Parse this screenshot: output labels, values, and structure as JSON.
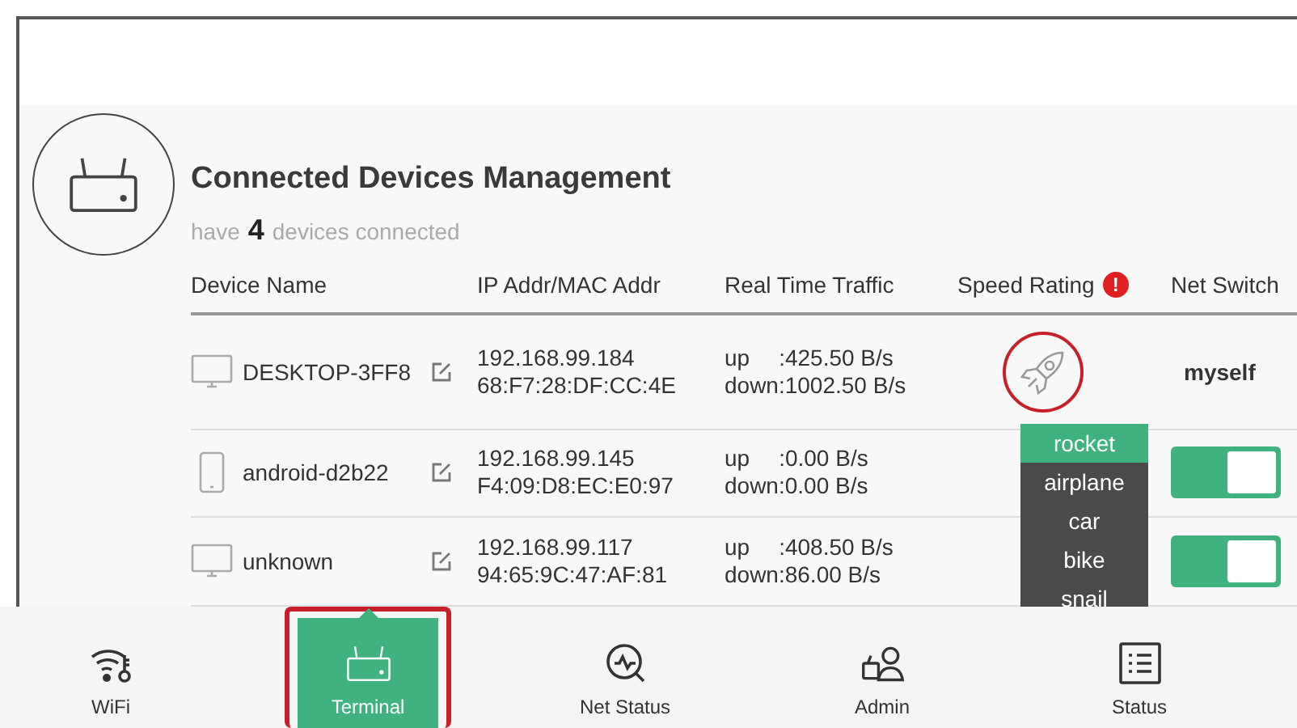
{
  "header": {
    "title": "Connected Devices Management",
    "count_prefix": "have",
    "count": "4",
    "count_suffix": "devices connected"
  },
  "table": {
    "columns": [
      {
        "label": "Device Name"
      },
      {
        "label": "IP Addr/MAC Addr"
      },
      {
        "label": "Real Time Traffic"
      },
      {
        "label": "Speed Rating",
        "alert_mark": "!"
      },
      {
        "label": "Net Switch"
      }
    ],
    "rows": [
      {
        "kind": "desktop",
        "name": "DESKTOP-3FF8",
        "ip": "192.168.99.184",
        "mac": "68:F7:28:DF:CC:4E",
        "up_label": "up",
        "up_value": ":425.50 B/s",
        "down": "down:1002.50 B/s",
        "speed": {
          "kind": "rocket",
          "circled": true
        },
        "net": {
          "kind": "label",
          "text": "myself"
        }
      },
      {
        "kind": "phone",
        "name": "android-d2b22",
        "ip": "192.168.99.145",
        "mac": "F4:09:D8:EC:E0:97",
        "up_label": "up",
        "up_value": ":0.00 B/s",
        "down": "down:0.00 B/s",
        "net": {
          "kind": "toggle",
          "on": true
        }
      },
      {
        "kind": "desktop",
        "name": "unknown",
        "ip": "192.168.99.117",
        "mac": "94:65:9C:47:AF:81",
        "up_label": "up",
        "up_value": ":408.50 B/s",
        "down": "down:86.00 B/s",
        "net": {
          "kind": "toggle",
          "on": true
        }
      }
    ],
    "speed_menu": [
      {
        "label": "rocket",
        "selected": true
      },
      {
        "label": "airplane",
        "selected": false
      },
      {
        "label": "car",
        "selected": false
      },
      {
        "label": "bike",
        "selected": false
      },
      {
        "label": "snail",
        "selected": false
      }
    ]
  },
  "nav": [
    {
      "kind": "wifi",
      "label": "WiFi",
      "selected": false
    },
    {
      "kind": "terminal",
      "label": "Terminal",
      "selected": true,
      "circled": true
    },
    {
      "kind": "netstatus",
      "label": "Net Status",
      "selected": false
    },
    {
      "kind": "admin",
      "label": "Admin",
      "selected": false
    },
    {
      "kind": "status",
      "label": "Status",
      "selected": false
    }
  ]
}
